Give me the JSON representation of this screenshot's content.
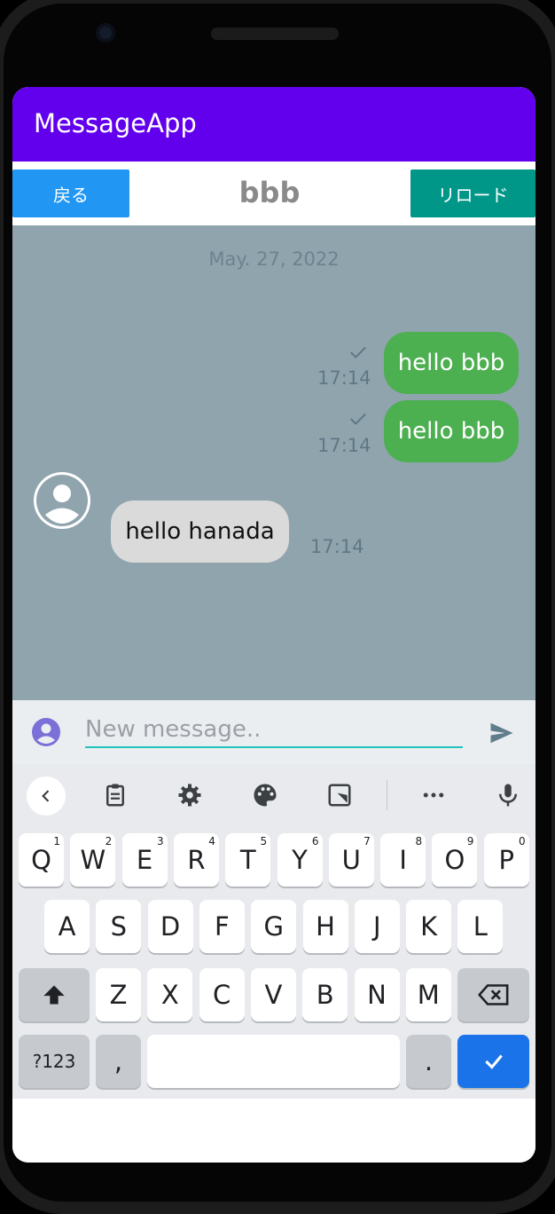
{
  "app": {
    "title": "MessageApp"
  },
  "header": {
    "back_label": "戻る",
    "title": "bbb",
    "reload_label": "リロード"
  },
  "chat": {
    "date": "May. 27, 2022",
    "messages": [
      {
        "direction": "out",
        "text": "hello bbb",
        "time": "17:14",
        "status": "sent"
      },
      {
        "direction": "out",
        "text": "hello bbb",
        "time": "17:14",
        "status": "sent"
      },
      {
        "direction": "in",
        "text": "hello hanada",
        "time": "17:14"
      }
    ]
  },
  "composer": {
    "placeholder": "New message..",
    "value": ""
  },
  "keyboard": {
    "toolbar_icons": [
      "chevron-left-icon",
      "clipboard-icon",
      "gear-icon",
      "palette-icon",
      "resize-icon",
      "more-icon",
      "mic-icon"
    ],
    "row1": [
      {
        "label": "Q",
        "hint": "1"
      },
      {
        "label": "W",
        "hint": "2"
      },
      {
        "label": "E",
        "hint": "3"
      },
      {
        "label": "R",
        "hint": "4"
      },
      {
        "label": "T",
        "hint": "5"
      },
      {
        "label": "Y",
        "hint": "6"
      },
      {
        "label": "U",
        "hint": "7"
      },
      {
        "label": "I",
        "hint": "8"
      },
      {
        "label": "O",
        "hint": "9"
      },
      {
        "label": "P",
        "hint": "0"
      }
    ],
    "row2": [
      "A",
      "S",
      "D",
      "F",
      "G",
      "H",
      "J",
      "K",
      "L"
    ],
    "row3": [
      "Z",
      "X",
      "C",
      "V",
      "B",
      "N",
      "M"
    ],
    "symbols_label": "?123",
    "comma_label": ",",
    "period_label": "."
  },
  "colors": {
    "appbar": "#6200EE",
    "back_button": "#2196F3",
    "reload_button": "#009688",
    "chat_background": "#90A4AE",
    "outgoing_bubble": "#4CAF50",
    "incoming_bubble": "#DADADA",
    "enter_key": "#1A73E8"
  }
}
